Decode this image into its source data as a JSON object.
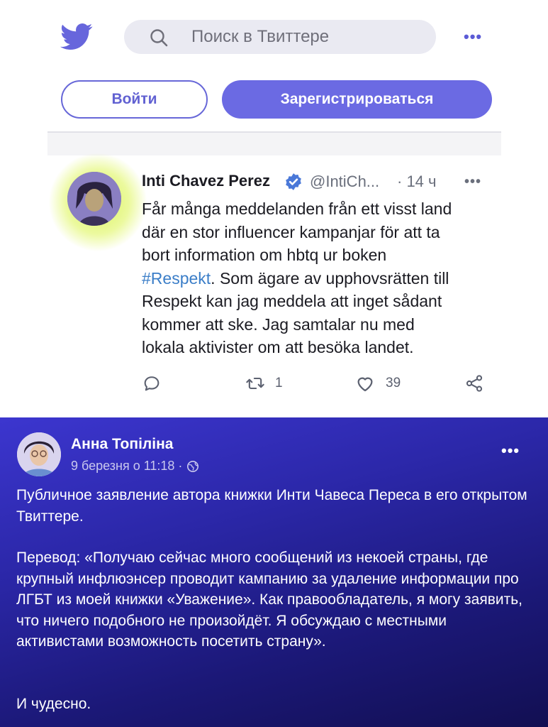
{
  "twitter": {
    "search_placeholder": "Поиск в Твиттере",
    "login_label": "Войти",
    "signup_label": "Зарегистрироваться",
    "tweet": {
      "author_name": "Inti Chavez Perez",
      "handle": "@IntiCh...",
      "time": "· 14 ч",
      "text_lines": [
        "Får många meddelanden från ett visst land",
        "där en stor influencer kampanjar för att ta",
        "bort information om hbtq ur boken"
      ],
      "hashtag": "#Respekt",
      "text_after_hashtag": ". Som ägare av upphovsrätten till",
      "text_lines_end": [
        "Respekt kan jag meddela att inget sådant",
        "kommer att ske. Jag samtalar nu med",
        "lokala aktivister om att besöka landet."
      ],
      "retweet_count": "1",
      "like_count": "39"
    },
    "colors": {
      "accent": "#6b6ae3",
      "hashtag": "#3b7ec8"
    },
    "icons": [
      "twitter-bird-icon",
      "search-icon",
      "more-icon",
      "verified-icon",
      "reply-icon",
      "retweet-icon",
      "like-icon",
      "share-icon"
    ]
  },
  "facebook": {
    "author_name": "Анна Топіліна",
    "date": "9 березня о 11:18 ·",
    "paragraphs": [
      "Публичное заявление автора книжки Инти Чавеса Переса в его открытом Твиттере.",
      "Перевод: «Получаю сейчас много сообщений из некоей страны, где крупный инфлюэнсер проводит кампанию за удаление информации про ЛГБТ из моей книжки «Уважение». Как правообладатель, я могу заявить, что ничего подобного не произойдёт. Я обсуждаю с местными активистами возможность посетить страну».",
      "И чудесно."
    ],
    "colors": {
      "background_top": "#3c36cf",
      "background_bottom": "#120f52"
    },
    "icons": [
      "globe-icon",
      "more-icon"
    ]
  }
}
